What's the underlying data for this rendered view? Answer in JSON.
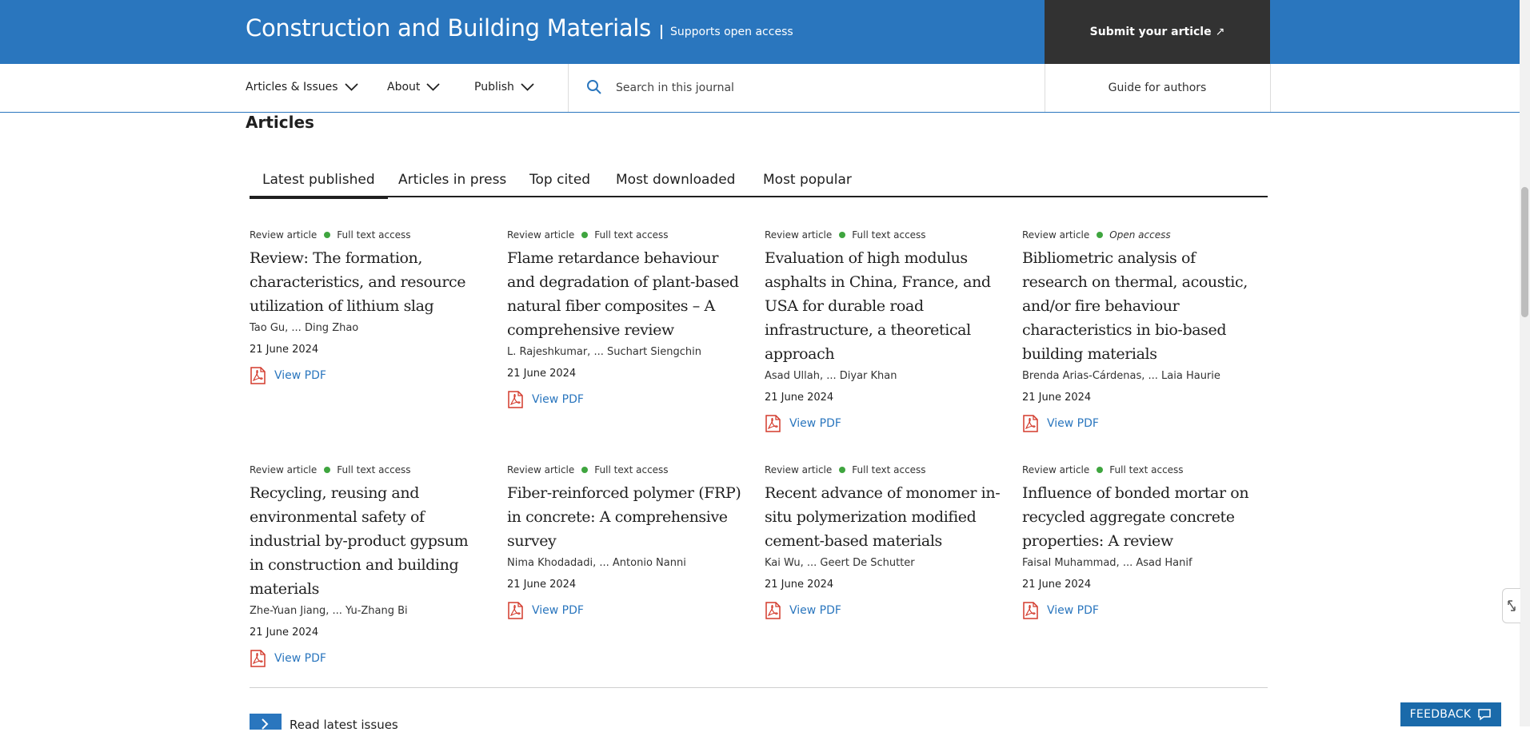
{
  "header": {
    "journal_title": "Construction and Building Materials",
    "open_access_label": "Supports open access",
    "submit_label": "Submit your article",
    "submit_arrow": "↗",
    "brand_color": "#2a76be",
    "submit_bg": "#323232"
  },
  "nav": {
    "items": [
      {
        "label": "Articles & Issues"
      },
      {
        "label": "About"
      },
      {
        "label": "Publish"
      }
    ],
    "search_placeholder": "Search in this journal",
    "guide_label": "Guide for authors"
  },
  "articles": {
    "section_title": "Articles",
    "tabs": [
      {
        "label": "Latest published",
        "active": true
      },
      {
        "label": "Articles in press"
      },
      {
        "label": "Top cited"
      },
      {
        "label": "Most downloaded"
      },
      {
        "label": "Most popular"
      }
    ],
    "items": [
      {
        "type": "Review article",
        "access": "Full text access",
        "title": "Review: The formation, characteristics, and resource utilization of lithium slag",
        "authors": "Tao Gu, ... Ding Zhao",
        "date": "21 June 2024",
        "pdf": "View PDF"
      },
      {
        "type": "Review article",
        "access": "Full text access",
        "title": "Flame retardance behaviour and degradation of plant-based natural fiber composites – A comprehensive review",
        "authors": "L. Rajeshkumar, ... Suchart Siengchin",
        "date": "21 June 2024",
        "pdf": "View PDF"
      },
      {
        "type": "Review article",
        "access": "Full text access",
        "title": "Evaluation of high modulus asphalts in China, France, and USA for durable road infrastructure, a theoretical approach",
        "authors": "Asad Ullah, ... Diyar Khan",
        "date": "21 June 2024",
        "pdf": "View PDF"
      },
      {
        "type": "Review article",
        "access": "Open access",
        "title": "Bibliometric analysis of research on thermal, acoustic, and/or fire behaviour characteristics in bio-based building materials",
        "authors": "Brenda Arias-Cárdenas, ... Laia Haurie",
        "date": "21 June 2024",
        "pdf": "View PDF"
      },
      {
        "type": "Review article",
        "access": "Full text access",
        "title": "Recycling, reusing and environmental safety of industrial by-product gypsum in construction and building materials",
        "authors": "Zhe-Yuan Jiang, ... Yu-Zhang Bi",
        "date": "21 June 2024",
        "pdf": "View PDF"
      },
      {
        "type": "Review article",
        "access": "Full text access",
        "title": "Fiber-reinforced polymer (FRP) in concrete: A comprehensive survey",
        "authors": "Nima Khodadadi, ... Antonio Nanni",
        "date": "21 June 2024",
        "pdf": "View PDF"
      },
      {
        "type": "Review article",
        "access": "Full text access",
        "title": "Recent advance of monomer in-situ polymerization modified cement-based materials",
        "authors": "Kai Wu, ... Geert De Schutter",
        "date": "21 June 2024",
        "pdf": "View PDF"
      },
      {
        "type": "Review article",
        "access": "Full text access",
        "title": "Influence of bonded mortar on recycled aggregate concrete properties: A review",
        "authors": "Faisal Muhammad, ... Asad Hanif",
        "date": "21 June 2024",
        "pdf": "View PDF"
      }
    ],
    "more_label": "Read latest issues"
  },
  "feedback_label": "FEEDBACK"
}
